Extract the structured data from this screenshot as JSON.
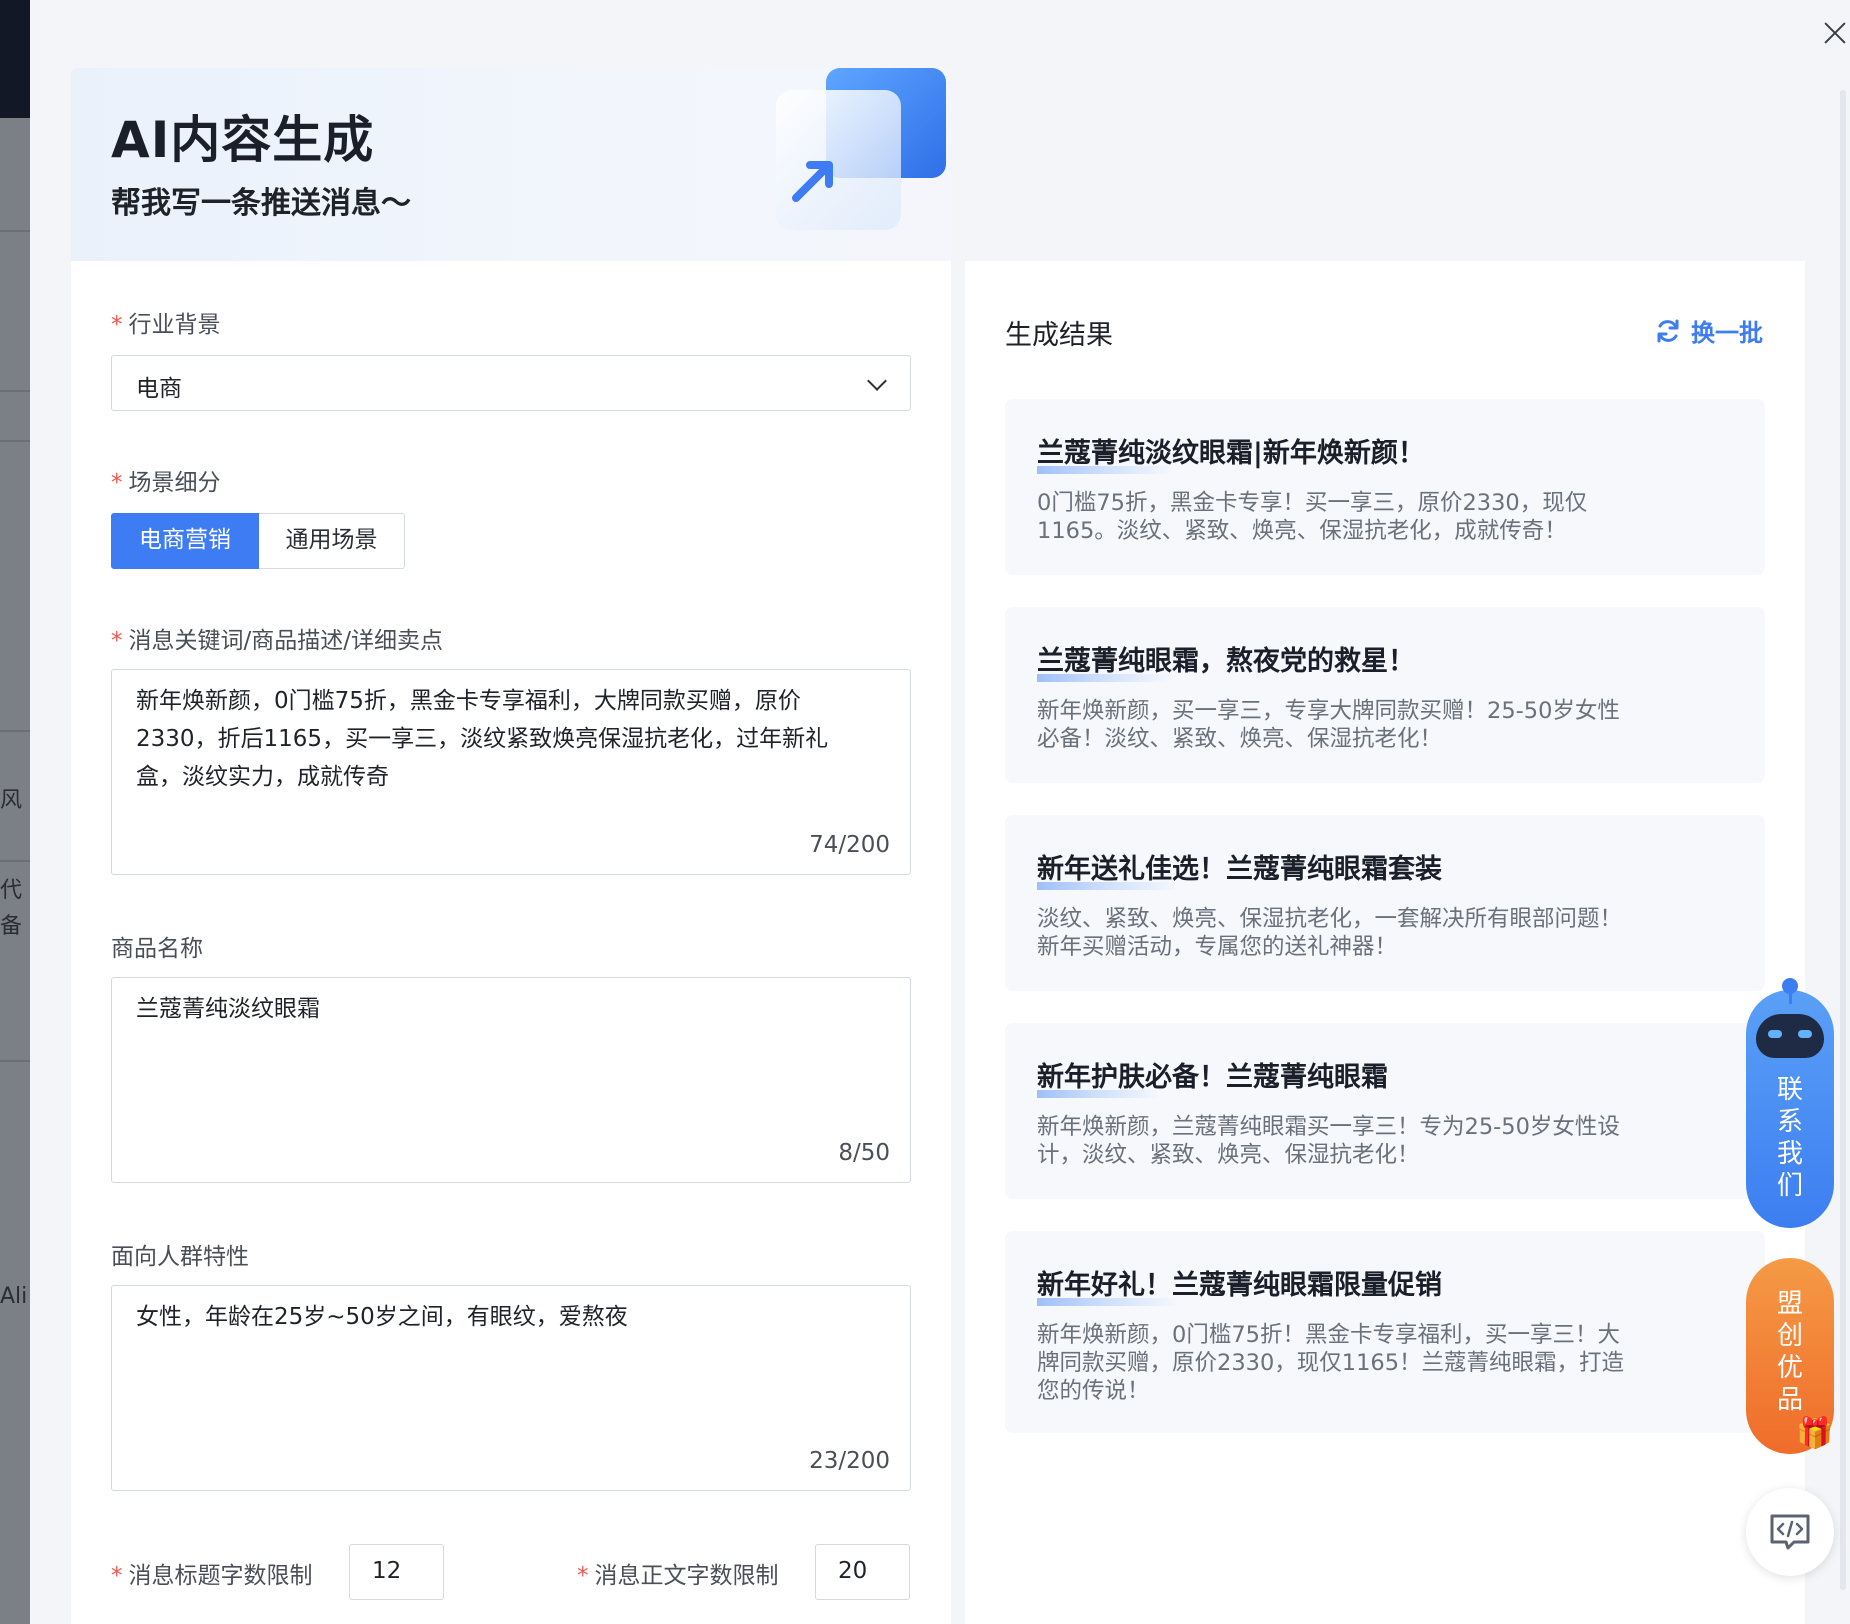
{
  "drawer": {
    "title": "AI内容生成",
    "subtitle": "帮我写一条推送消息～"
  },
  "form": {
    "industry": {
      "label": "行业背景",
      "value": "电商"
    },
    "scene": {
      "label": "场景细分",
      "options": [
        "电商营销",
        "通用场景"
      ],
      "selected": "电商营销"
    },
    "keywords": {
      "label": "消息关键词/商品描述/详细卖点",
      "value": "新年焕新颜，0门槛75折，黑金卡专享福利，大牌同款买赠，原价2330，折后1165，买一享三，淡纹紧致焕亮保湿抗老化，过年新礼盒，淡纹实力，成就传奇",
      "count": "74/200"
    },
    "product": {
      "label": "商品名称",
      "value": "兰蔻菁纯淡纹眼霜",
      "count": "8/50"
    },
    "audience": {
      "label": "面向人群特性",
      "value": "女性，年龄在25岁~50岁之间，有眼纹，爱熬夜",
      "count": "23/200"
    },
    "title_limit": {
      "label": "消息标题字数限制",
      "value": "12"
    },
    "body_limit": {
      "label": "消息正文字数限制",
      "value": "20"
    }
  },
  "results": {
    "title": "生成结果",
    "refresh_label": "换一批",
    "items": [
      {
        "title": "兰蔻菁纯淡纹眼霜|新年焕新颜！",
        "body": "0门槛75折，黑金卡专享！买一享三，原价2330，现仅1165。淡纹、紧致、焕亮、保湿抗老化，成就传奇！"
      },
      {
        "title": "兰蔻菁纯眼霜，熬夜党的救星！",
        "body": "新年焕新颜，买一享三，专享大牌同款买赠！25-50岁女性必备！淡纹、紧致、焕亮、保湿抗老化！"
      },
      {
        "title": "新年送礼佳选！兰蔻菁纯眼霜套装",
        "body": "淡纹、紧致、焕亮、保湿抗老化，一套解决所有眼部问题！新年买赠活动，专属您的送礼神器！"
      },
      {
        "title": "新年护肤必备！兰蔻菁纯眼霜",
        "body": "新年焕新颜，兰蔻菁纯眼霜买一享三！专为25-50岁女性设计，淡纹、紧致、焕亮、保湿抗老化！"
      },
      {
        "title": "新年好礼！兰蔻菁纯眼霜限量促销",
        "body": "新年焕新颜，0门槛75折！黑金卡专享福利，买一享三！大牌同款买赠，原价2330，现仅1165！兰蔻菁纯眼霜，打造您的传说！"
      }
    ]
  },
  "floating": {
    "contact_label": "联系我们",
    "promo_label": "盟创优品"
  },
  "backdrop": {
    "fragments": [
      "风",
      "代",
      "备",
      "Ali"
    ]
  },
  "colors": {
    "primary": "#3d7cf3",
    "required": "#f2574c",
    "contact": "#3c7ef1",
    "promo": "#ef6c2a"
  }
}
